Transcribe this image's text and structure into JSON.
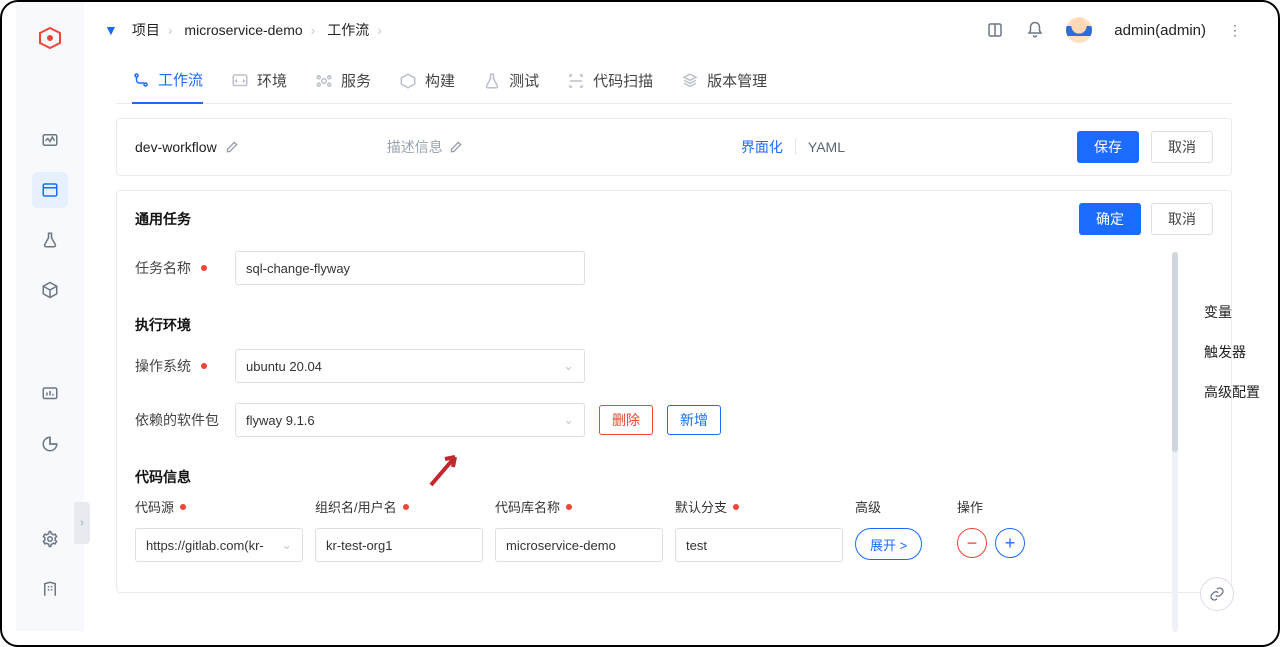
{
  "breadcrumb": {
    "root": "项目",
    "project": "microservice-demo",
    "section": "工作流"
  },
  "user": {
    "display": "admin(admin)"
  },
  "tabs": {
    "workflow": "工作流",
    "env": "环境",
    "service": "服务",
    "build": "构建",
    "test": "测试",
    "codescan": "代码扫描",
    "version": "版本管理"
  },
  "wf": {
    "name": "dev-workflow",
    "desc_label": "描述信息",
    "toggle_ui": "界面化",
    "toggle_yaml": "YAML",
    "save": "保存",
    "cancel": "取消"
  },
  "panel": {
    "title": "通用任务",
    "ok": "确定",
    "cancel": "取消",
    "task_name_label": "任务名称",
    "task_name_value": "sql-change-flyway",
    "exec_env_title": "执行环境",
    "os_label": "操作系统",
    "os_value": "ubuntu 20.04",
    "dep_label": "依赖的软件包",
    "dep_value": "flyway 9.1.6",
    "delete": "删除",
    "add": "新增",
    "code_title": "代码信息",
    "code_source": "代码源",
    "org_user": "组织名/用户名",
    "repo": "代码库名称",
    "branch": "默认分支",
    "advanced": "高级",
    "ops": "操作",
    "code_source_value": "https://gitlab.com(kr-",
    "org_user_value": "kr-test-org1",
    "repo_value": "microservice-demo",
    "branch_value": "test",
    "expand": "展开 >"
  },
  "side": {
    "vars": "变量",
    "triggers": "触发器",
    "advanced": "高级配置"
  }
}
